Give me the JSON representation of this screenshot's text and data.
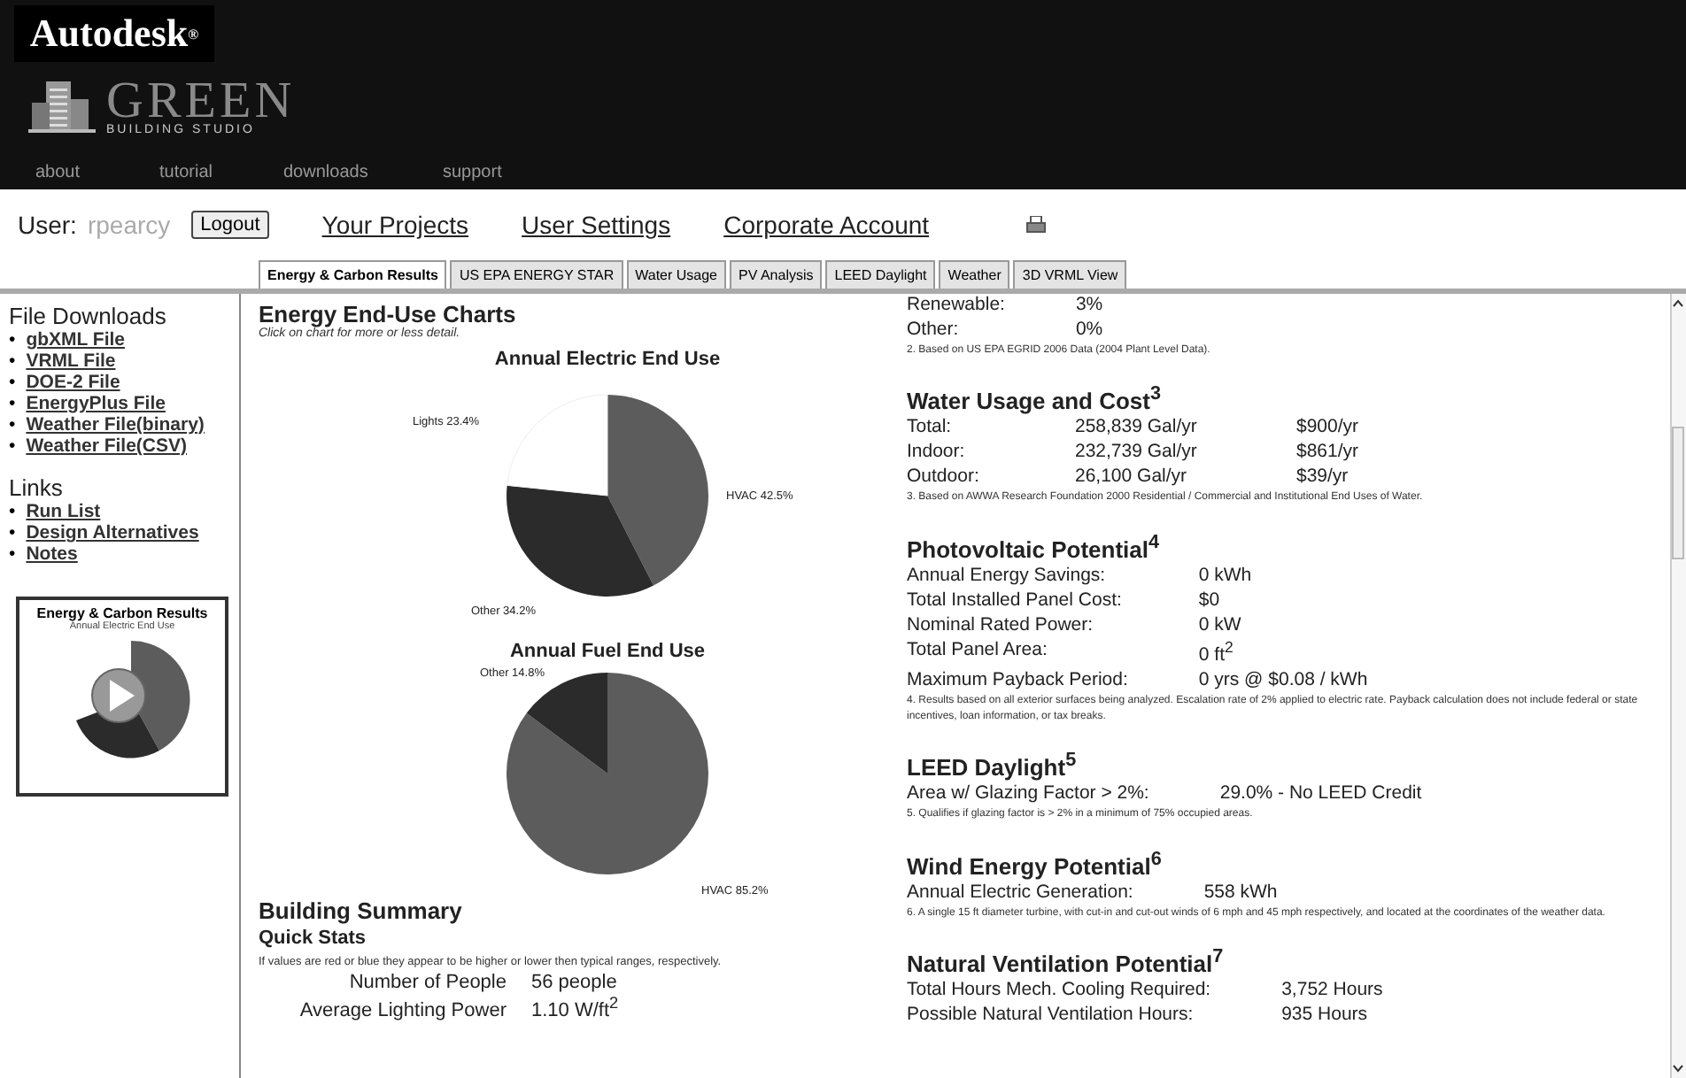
{
  "brand": {
    "autodesk": "Autodesk",
    "mark": "®",
    "product": "GREEN",
    "subtitle": "BUILDING STUDIO"
  },
  "nav": [
    "about",
    "tutorial",
    "downloads",
    "support"
  ],
  "user": {
    "label": "User:",
    "name": "rpearcy",
    "logout": "Logout",
    "links": [
      "Your Projects",
      "User Settings",
      "Corporate Account"
    ]
  },
  "tabs": [
    {
      "label": "Energy & Carbon Results",
      "selected": true
    },
    {
      "label": "US EPA ENERGY STAR",
      "selected": false
    },
    {
      "label": "Water Usage",
      "selected": false
    },
    {
      "label": "PV Analysis",
      "selected": false
    },
    {
      "label": "LEED Daylight",
      "selected": false
    },
    {
      "label": "Weather",
      "selected": false
    },
    {
      "label": "3D VRML View",
      "selected": false
    }
  ],
  "sidebar": {
    "bullet": "•",
    "downloads_title": "File Downloads",
    "downloads": [
      "gbXML File",
      "VRML File",
      "DOE-2 File",
      "EnergyPlus File",
      "Weather File(binary)",
      "Weather File(CSV)"
    ],
    "links_title": "Links",
    "links": [
      "Run List",
      "Design Alternatives",
      "Notes"
    ],
    "video": {
      "title": "Energy & Carbon Results",
      "subtitle": "Annual Electric End Use"
    }
  },
  "charts": {
    "title": "Energy End-Use Charts",
    "hint": "Click on chart for more or less detail.",
    "items": [
      {
        "chart_data": {
          "type": "pie",
          "title": "Annual Electric End Use",
          "categories": [
            "HVAC 42.5%",
            "Other 34.2%",
            "Lights 23.4%"
          ],
          "series": [
            {
              "values": [
                42.5,
                34.2,
                23.4
              ]
            }
          ]
        }
      },
      {
        "chart_data": {
          "type": "pie",
          "title": "Annual Fuel End Use",
          "categories": [
            "HVAC 85.2%",
            "Other 14.8%"
          ],
          "series": [
            {
              "values": [
                85.2,
                14.8
              ]
            }
          ]
        }
      }
    ]
  },
  "building_summary": {
    "title": "Building Summary",
    "subtitle": "Quick Stats",
    "note": "If values are red or blue they appear to be higher or lower then typical ranges, respectively.",
    "stats": [
      {
        "label": "Number of People",
        "value": "56 people"
      },
      {
        "label": "Average Lighting Power",
        "value": "1.10 W/ft$^{2}$"
      }
    ]
  },
  "sections": [
    {
      "rows": [
        [
          "Renewable:",
          "3%"
        ],
        [
          "Other:",
          "0%"
        ]
      ],
      "footnote": "2. Based on US EPA EGRID 2006 Data (2004 Plant Level Data)."
    },
    {
      "title": "Water Usage and Cost$^{3}$",
      "rows": [
        [
          "Total:",
          "258,839 Gal/yr",
          "$900/yr"
        ],
        [
          "Indoor:",
          "232,739 Gal/yr",
          "$861/yr"
        ],
        [
          "Outdoor:",
          "26,100 Gal/yr",
          "$39/yr"
        ]
      ],
      "footnote": "3. Based on AWWA Research Foundation 2000 Residential / Commercial and Institutional End Uses of Water."
    },
    {
      "title": "Photovoltaic Potential$^{4}$",
      "rows": [
        [
          "Annual Energy Savings:",
          "0 kWh"
        ],
        [
          "Total Installed Panel Cost:",
          "$0"
        ],
        [
          "Nominal Rated Power:",
          "0 kW"
        ],
        [
          "Total Panel Area:",
          "0 ft$^{2}$"
        ],
        [
          "Maximum Payback Period:",
          "0 yrs @ $0.08 / kWh"
        ]
      ],
      "footnote": "4. Results based on all exterior surfaces being analyzed. Escalation rate of 2% applied to electric rate. Payback calculation does not include federal or state incentives, loan information, or tax breaks."
    },
    {
      "title": "LEED Daylight$^{5}$",
      "rows": [
        [
          "Area w/ Glazing Factor > 2%:",
          "29.0% - No LEED Credit"
        ]
      ],
      "footnote": "5. Qualifies if glazing factor is > 2% in a minimum of 75% occupied areas."
    },
    {
      "title": "Wind Energy Potential$^{6}$",
      "rows": [
        [
          "Annual Electric Generation:",
          "558 kWh"
        ]
      ],
      "footnote": "6. A single 15 ft diameter turbine, with cut-in and cut-out winds of 6 mph and 45 mph respectively, and located at the coordinates of the weather data."
    },
    {
      "title": "Natural Ventilation Potential$^{7}$",
      "rows": [
        [
          "Total Hours Mech. Cooling Required:",
          "3,752 Hours"
        ],
        [
          "Possible Natural Ventilation Hours:",
          "935 Hours"
        ]
      ]
    }
  ]
}
